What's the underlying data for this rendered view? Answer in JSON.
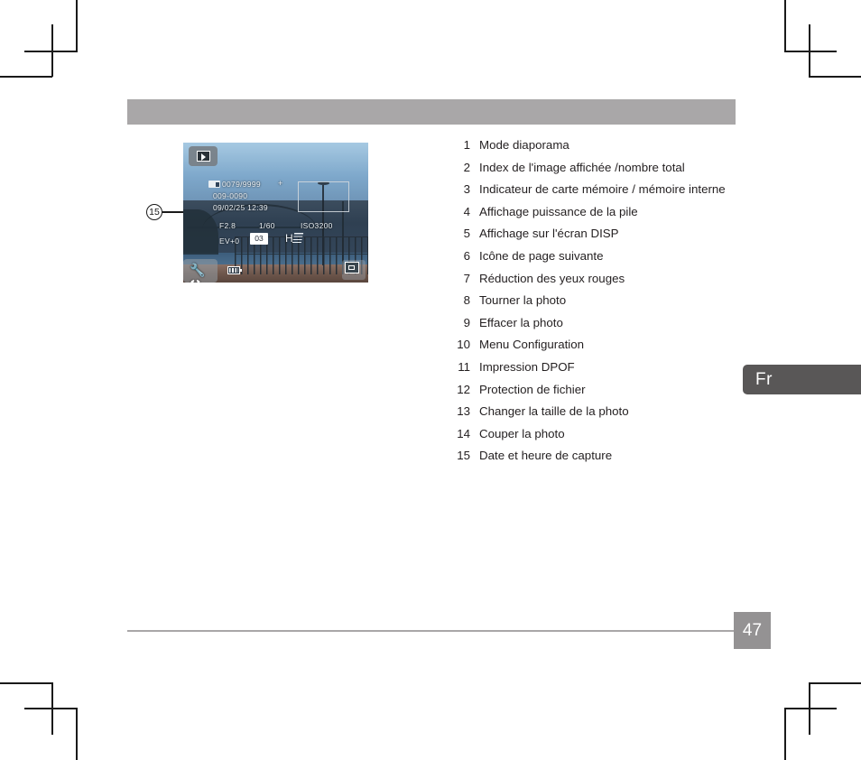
{
  "page": {
    "number": "47",
    "language_tab": "Fr",
    "header_title": ""
  },
  "callout": {
    "number": "15"
  },
  "camera_lcd": {
    "playback_icon": "slideshow-playback-icon",
    "setup_icon": "tools-wrench-icon",
    "battery_icon": "battery-icon",
    "resize_icon": "resize-photo-icon",
    "card_icon": "memory-card-icon",
    "dpof_icon": "dpof-print-icon",
    "redeye_icon": "red-eye-reduction-icon",
    "image_count": "0079/9999",
    "plus_marker": "+",
    "file_number": "009-0090",
    "date_time": "09/02/25  12:39",
    "aperture": "F2.8",
    "shutter_speed": "1/60",
    "iso": "ISO3200",
    "exposure_value": "EV+0",
    "dpof_count": "03",
    "redeye_letter": "H"
  },
  "legend": {
    "items": [
      {
        "num": "1",
        "label": "Mode diaporama"
      },
      {
        "num": "2",
        "label": "Index de l'image affichée /nombre total"
      },
      {
        "num": "3",
        "label": "Indicateur de carte mémoire / mémoire interne"
      },
      {
        "num": "4",
        "label": "Affichage puissance de la pile"
      },
      {
        "num": "5",
        "label": "Affichage sur l'écran DISP"
      },
      {
        "num": "6",
        "label": "Icône de page suivante"
      },
      {
        "num": "7",
        "label": "Réduction des yeux rouges"
      },
      {
        "num": "8",
        "label": "Tourner la photo"
      },
      {
        "num": "9",
        "label": "Effacer la photo"
      },
      {
        "num": "10",
        "label": "Menu Configuration"
      },
      {
        "num": "11",
        "label": "Impression DPOF"
      },
      {
        "num": "12",
        "label": "Protection de fichier"
      },
      {
        "num": "13",
        "label": "Changer la taille de la photo"
      },
      {
        "num": "14",
        "label": "Couper la photo"
      },
      {
        "num": "15",
        "label": "Date et heure de capture"
      }
    ]
  },
  "colors": {
    "header_band": "#a9a7a8",
    "language_tab": "#595757",
    "page_number_bg": "#949293",
    "text": "#231f20"
  }
}
